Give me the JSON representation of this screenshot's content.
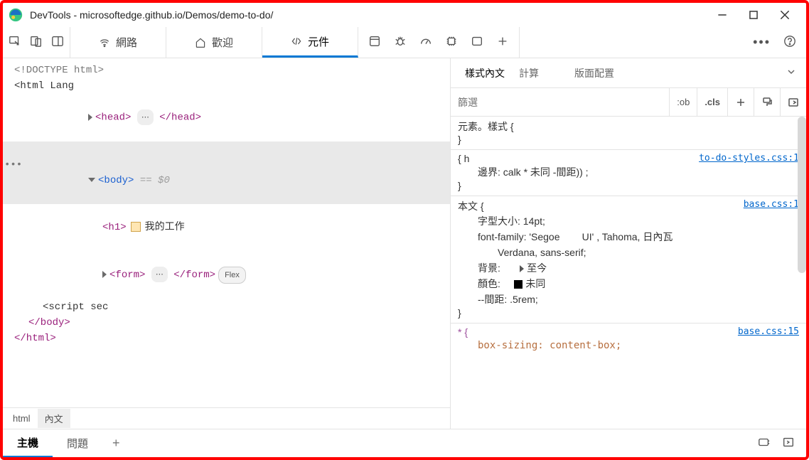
{
  "window": {
    "title": "DevTools - microsoftedge.github.io/Demos/demo-to-do/"
  },
  "toolbar": {
    "tabs": {
      "network": "網路",
      "welcome": "歡迎",
      "elements": "元件"
    }
  },
  "dom": {
    "doctype": "<!DOCTYPE html>",
    "html_open": "<html Lang",
    "head_open": "<head>",
    "head_ellipsis": "⋯",
    "head_close": "</head>",
    "body_open": "<body>",
    "body_eq": " == $0",
    "h1_open": "<h1>",
    "h1_text": "我的工作",
    "form_open": "<form>",
    "form_ellipsis": "⋯",
    "form_close": "</form>",
    "flex_badge": "Flex",
    "script": "<script sec",
    "body_close": "</body>",
    "html_close": "</html>",
    "row_dots": "•••"
  },
  "breadcrumb": {
    "html": "html",
    "body": "內文"
  },
  "bottom": {
    "console": "主機",
    "issues": "問題"
  },
  "styles": {
    "tab_styles": "樣式內文",
    "tab_computed": "計算",
    "tab_layout": "版面配置",
    "filter_placeholder": "篩選",
    "chip_hov": ":ob",
    "chip_cls": ".cls",
    "rule1_selector": "元素。樣式 {",
    "rule1_close": "}",
    "rule2_selector": "{ h",
    "rule2_source": "to-do-styles.css:1",
    "rule2_decl1": "邊界: calk          *  未同   -間距)) ;",
    "rule2_close": "}",
    "rule3_selector": "本文 {",
    "rule3_source": "base.css:1",
    "rule3_decl1": "字型大小: 14pt;",
    "rule3_decl2a": "font-family:  'Segoe",
    "rule3_decl2b": "UI' ,    Tahoma,    日內瓦",
    "rule3_decl2c": "Verdana,  sans-serif;",
    "rule3_decl3": "背景:",
    "rule3_decl3b": "至今",
    "rule3_decl4": "顏色:",
    "rule3_decl4b": "未同",
    "rule3_decl5": "--間距: .5rem;",
    "rule3_close": "}",
    "rule4_selector": "* {",
    "rule4_source": "base.css:15",
    "rule4_decl1": "box-sizing: content-box;"
  }
}
